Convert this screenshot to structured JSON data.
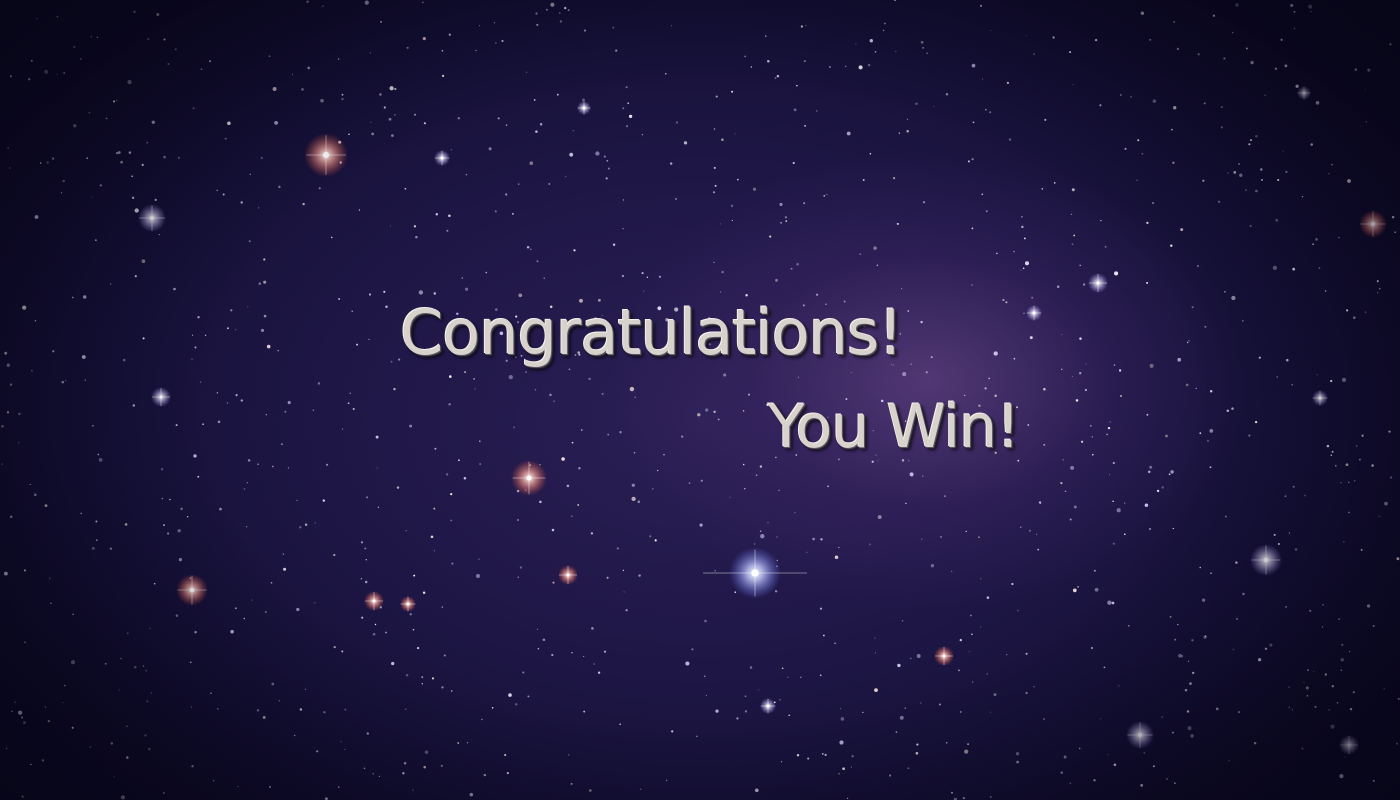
{
  "screen": {
    "name": "win-screen",
    "title": "Congratulations!",
    "subtitle": "You Win!"
  },
  "colors": {
    "sky_dark": "#0a0820",
    "sky_mid": "#1d1644",
    "nebula": "#785096",
    "text": "#d8d2cc"
  }
}
